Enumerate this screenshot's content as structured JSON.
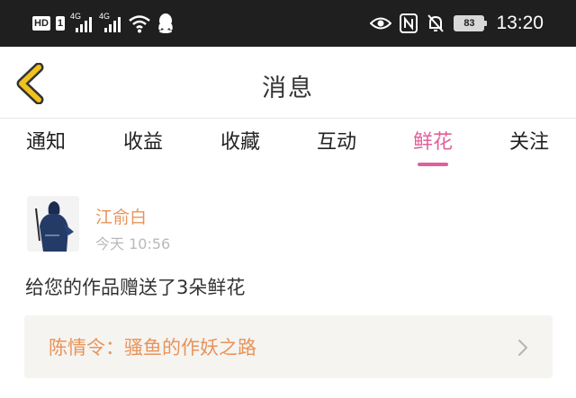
{
  "status_bar": {
    "hd_label": "HD",
    "sim_badge": "1",
    "signal_1_label": "4G",
    "signal_2_label": "4G",
    "battery_level": "83",
    "time": "13:20",
    "icons": [
      "hd-icon",
      "signal-icon",
      "signal-icon",
      "wifi-icon",
      "qq-icon",
      "eye-icon",
      "nfc-icon",
      "mute-bell-icon",
      "battery-icon"
    ]
  },
  "header": {
    "title": "消息",
    "back_icon": "chevron-left-icon"
  },
  "tabs": [
    {
      "label": "通知",
      "active": false
    },
    {
      "label": "收益",
      "active": false
    },
    {
      "label": "收藏",
      "active": false
    },
    {
      "label": "互动",
      "active": false
    },
    {
      "label": "鲜花",
      "active": true
    },
    {
      "label": "关注",
      "active": false
    }
  ],
  "message": {
    "user_name": "江俞白",
    "time": "今天 10:56",
    "body": "给您的作品赠送了3朵鲜花",
    "work_title": "陈情令：骚鱼的作妖之路"
  },
  "colors": {
    "status_bar_bg": "#1f1f1f",
    "accent_pink": "#e0609a",
    "accent_orange": "#e8935a",
    "back_arrow_yellow": "#f0c21e",
    "card_bg": "#f5f4f1"
  }
}
